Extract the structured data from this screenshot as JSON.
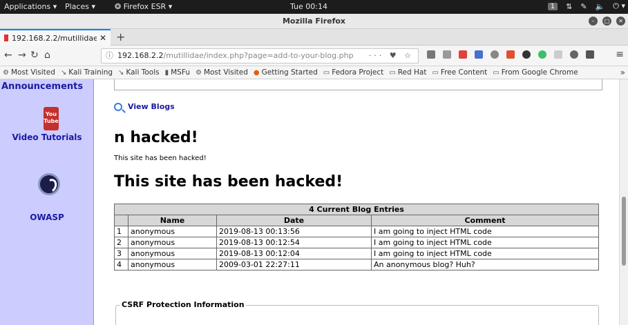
{
  "os_bar": {
    "applications": "Applications ▾",
    "places": "Places ▾",
    "firefox": "Firefox ESR ▾",
    "clock": "Tue 00:14",
    "workspace": "1"
  },
  "window": {
    "title": "Mozilla Firefox"
  },
  "tab": {
    "label_visible": "192.168.2.2/mutillidae/",
    "label_faded": "in"
  },
  "url": {
    "host": "192.168.2.2",
    "path": "/mutillidae/index.php?page=add-to-your-blog.php"
  },
  "bookmarks": [
    {
      "icon": "gear-icon",
      "label": "Most Visited"
    },
    {
      "icon": "kali-icon",
      "label": "Kali Training"
    },
    {
      "icon": "kali-icon",
      "label": "Kali Tools"
    },
    {
      "icon": "msf-icon",
      "label": "MSFu"
    },
    {
      "icon": "gear-icon",
      "label": "Most Visited"
    },
    {
      "icon": "firefox-icon",
      "label": "Getting Started"
    },
    {
      "icon": "folder-icon",
      "label": "Fedora Project"
    },
    {
      "icon": "folder-icon",
      "label": "Red Hat"
    },
    {
      "icon": "folder-icon",
      "label": "Free Content"
    },
    {
      "icon": "folder-icon",
      "label": "From Google Chrome"
    }
  ],
  "sidebar": {
    "announcements": "Announcements",
    "youtube_badge": "You Tube",
    "video_tutorials": "Video Tutorials",
    "owasp": "OWASP"
  },
  "main": {
    "view_blogs": "View Blogs",
    "heading_partial": "n hacked!",
    "paragraph": "This site has been hacked!",
    "heading_big": "This site has been hacked!",
    "table": {
      "caption": "4 Current Blog Entries",
      "headers": [
        "",
        "Name",
        "Date",
        "Comment"
      ],
      "rows": [
        [
          "1",
          "anonymous",
          "2019-08-13 00:13:56",
          "I am going to inject HTML code"
        ],
        [
          "2",
          "anonymous",
          "2019-08-13 00:12:54",
          "I am going to inject HTML code"
        ],
        [
          "3",
          "anonymous",
          "2019-08-13 00:12:04",
          "I am going to inject HTML code"
        ],
        [
          "4",
          "anonymous",
          "2009-03-01 22:27:11",
          "An anonymous blog? Huh?"
        ]
      ]
    },
    "csrf_legend": "CSRF Protection Information"
  },
  "colors": {
    "sidebar_bg": "#ccccff",
    "link_blue": "#1a1aa0",
    "tab_accent": "#0a84ff"
  }
}
